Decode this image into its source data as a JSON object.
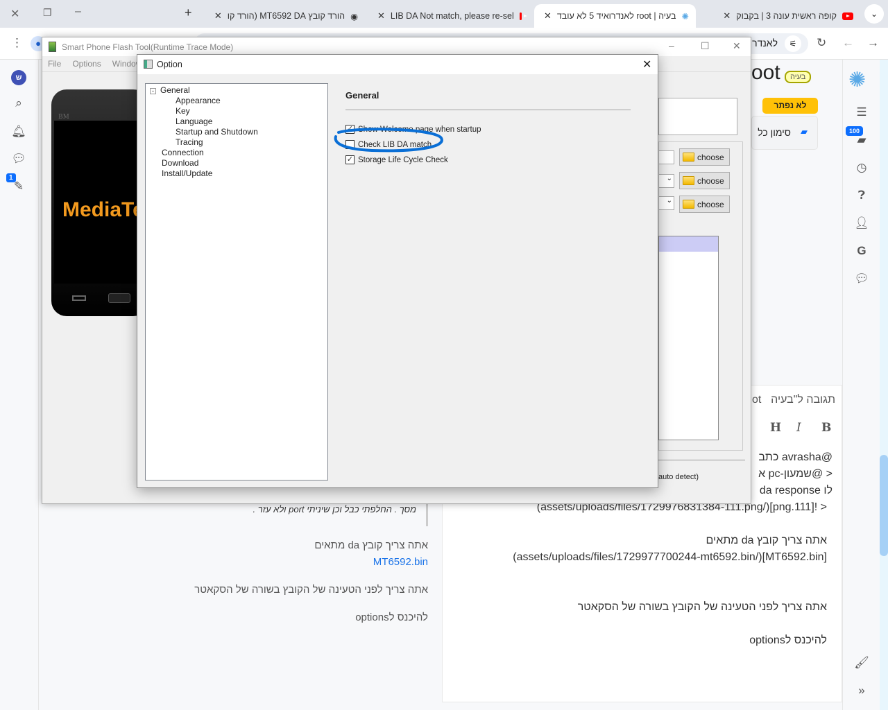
{
  "browser": {
    "tabs": [
      {
        "title": "קופה ראשית עונה 3 | בקבוק",
        "icon": "youtube-icon"
      },
      {
        "title": "בעיה | root לאנדרואיד 5 לא עובד",
        "icon": "site-icon",
        "active": true
      },
      {
        "title": "LIB DA Not match, please re-sel",
        "icon": "youtube-icon"
      },
      {
        "title": "הורד קובץ MT6592 DA (הורד קו",
        "icon": "globe-icon"
      }
    ],
    "address_text": "לאנדר"
  },
  "left_sidebar": {
    "avatar_letter": "ש",
    "compose_badge": "1"
  },
  "right_sidebar": {
    "inbox_badge": "100"
  },
  "topic": {
    "title_fragment": "oot",
    "status_badge": "בעיה",
    "unsolved_badge": "לא נפתר",
    "mark_all": "סימון כל"
  },
  "reply": {
    "header": "תגובה ל\"בעיה",
    "header_fragment": "ot",
    "format_buttons": [
      "B",
      "I",
      "H"
    ],
    "lines": [
      "@avrasha כתב",
      "< @שמעון-pc א",
      "לו da response",
      "< ![111.png](/assets/uploads/files/1729976831384-111.png)",
      "אתה צריך קובץ da מתאים",
      "[MT6592.bin](/assets/uploads/files/1729977700244-mt6592.bin)",
      "אתה צריך לפני הטעינה של הקובץ בשורה של הסקאטר",
      "להיכנס לoptions"
    ]
  },
  "post": {
    "quote": "מסך . החלפתי כבל וכן שיניתי port ולא עזר .",
    "line1": "אתה צריך קובץ da מתאים",
    "link": "MT6592.bin",
    "line2": "אתה צריך לפני הטעינה של הקובץ בשורה של הסקאטר",
    "line3": "להיכנס לoptions"
  },
  "flash_tool": {
    "title": "Smart Phone Flash Tool(Runtime Trace Mode)",
    "menu": [
      "File",
      "Options",
      "Window"
    ],
    "phone_brand": "MediaTek",
    "phone_label": "BM",
    "choose_label": "choose",
    "status": "auto detect)"
  },
  "option_dialog": {
    "title": "Option",
    "tree": [
      {
        "label": "General",
        "level": 0,
        "expanded": true
      },
      {
        "label": "Appearance",
        "level": 1
      },
      {
        "label": "Key",
        "level": 1
      },
      {
        "label": "Language",
        "level": 1
      },
      {
        "label": "Startup and Shutdown",
        "level": 1
      },
      {
        "label": "Tracing",
        "level": 1
      },
      {
        "label": "Connection",
        "level": 0
      },
      {
        "label": "Download",
        "level": 0
      },
      {
        "label": "Install/Update",
        "level": 0
      }
    ],
    "section": "General",
    "options": [
      {
        "label": "Show Welcome page when startup",
        "checked": true
      },
      {
        "label": "Check LIB DA match",
        "checked": false
      },
      {
        "label": "Storage Life Cycle Check",
        "checked": true
      }
    ],
    "annotation_color": "#0a6fd6"
  }
}
